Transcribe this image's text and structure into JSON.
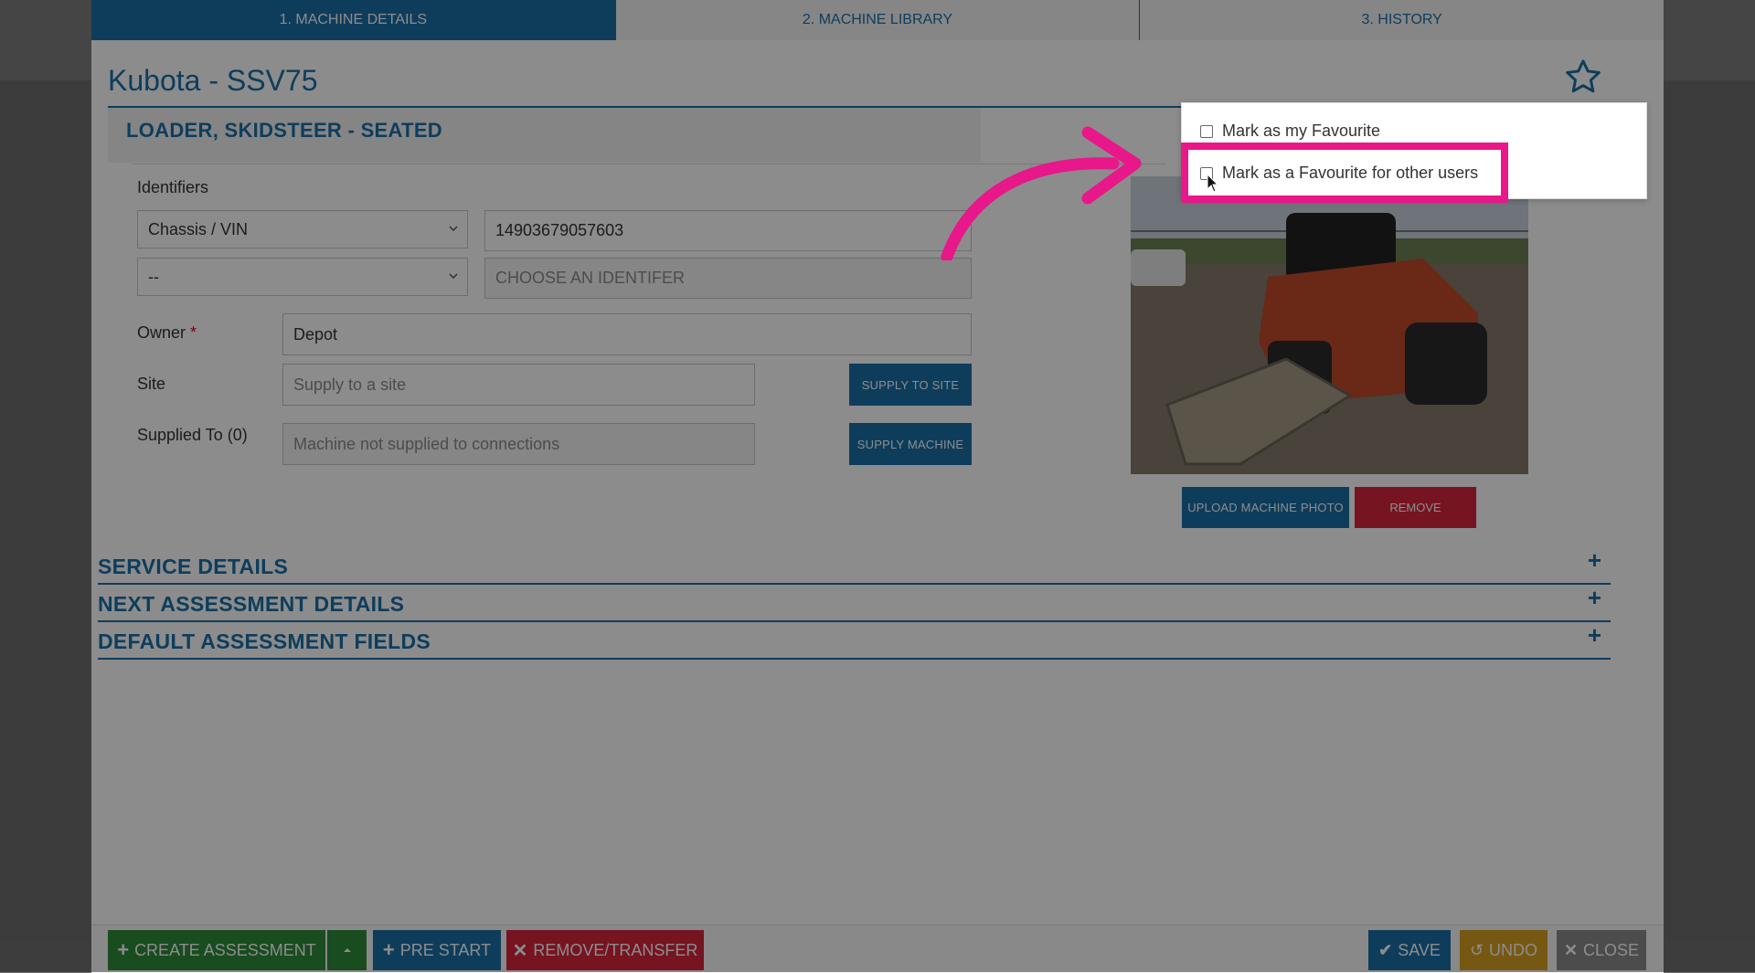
{
  "tabs": [
    {
      "label": "1. MACHINE DETAILS",
      "active": true
    },
    {
      "label": "2. MACHINE LIBRARY",
      "active": false
    },
    {
      "label": "3. HISTORY",
      "active": false
    }
  ],
  "machine": {
    "title": "Kubota - SSV75",
    "category": "LOADER, SKIDSTEER - SEATED"
  },
  "identifiers": {
    "label": "Identifiers",
    "type1_selected": "Chassis / VIN",
    "value1": "14903679057603",
    "type2_selected": "--",
    "value2_placeholder": "CHOOSE AN IDENTIFER"
  },
  "owner": {
    "label": "Owner",
    "required_mark": "*",
    "value": "Depot"
  },
  "site": {
    "label": "Site",
    "placeholder": "Supply to a site",
    "button": "SUPPLY TO SITE"
  },
  "supplied_to": {
    "label": "Supplied To (0)",
    "placeholder": "Machine not supplied to connections",
    "button": "SUPPLY MACHINE"
  },
  "photo": {
    "upload_button": "UPLOAD MACHINE PHOTO",
    "remove_button": "REMOVE"
  },
  "sections": [
    {
      "title": "SERVICE DETAILS",
      "toggle": "+"
    },
    {
      "title": "NEXT ASSESSMENT DETAILS",
      "toggle": "+"
    },
    {
      "title": "DEFAULT ASSESSMENT FIELDS",
      "toggle": "+"
    }
  ],
  "favourites": {
    "mine": {
      "label": "Mark as my Favourite",
      "checked": false
    },
    "others": {
      "label": "Mark as a Favourite for other users",
      "checked": false
    }
  },
  "footer": {
    "create_assessment": "CREATE ASSESSMENT",
    "pre_start": "PRE START",
    "remove_transfer": "REMOVE/TRANSFER",
    "save": "SAVE",
    "undo": "UNDO",
    "close": "CLOSE"
  },
  "colors": {
    "primary": "#1b6fa8",
    "danger": "#d7263d",
    "success": "#2e8b3a",
    "highlight": "#e8178a",
    "undo": "#d9a021",
    "neutral": "#8a8a8a"
  }
}
